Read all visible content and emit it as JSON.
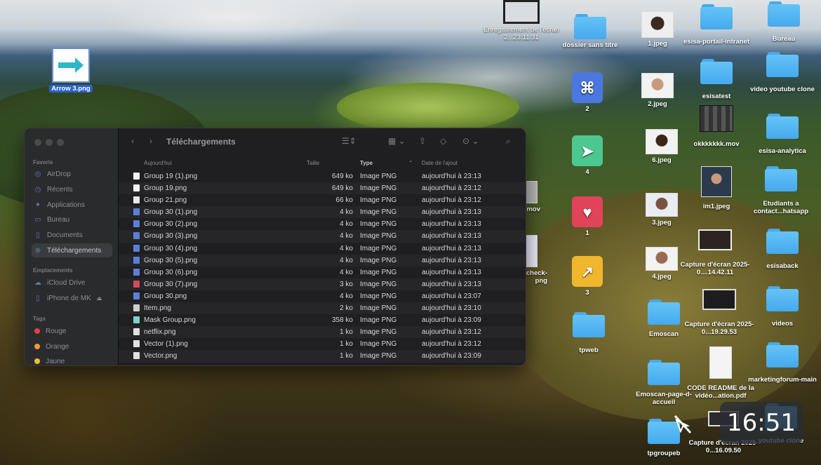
{
  "desktop": {
    "selected_icon": {
      "label": "Arrow 3.png"
    },
    "icons": {
      "recording": "Enregistrement de l'écran 2...23.11.31",
      "dossier": "dossier sans titre",
      "img1": "1.jpeg",
      "esisa_portail": "esisa-portail-intranet",
      "bureau": "Bureau",
      "app2": "2",
      "img2": "2.jpeg",
      "esisatest": "esisatest",
      "video_youtube": "video youtube clone",
      "mov": "okkkkkkk.mov",
      "img6": "6.jpeg",
      "app4": "4",
      "esisa_analytica": "esisa-analytica",
      "im1": "im1.jpeg",
      "etudiants": "Etudiants a contact...hatsapp",
      "app1": "1",
      "img3": "3.jpeg",
      "capture1": "Capture d'écran 2025-0....14.42.11",
      "esisaback": "esisaback",
      "app3": "3",
      "img4": "4.jpeg",
      "emoscan": "Emoscan",
      "capture2": "Capture d'écran 2025-0...19.29.53",
      "videos": "videos",
      "tpweb": "tpweb",
      "emoscan_page": "Emoscan-page-d-accueil",
      "code_readme": "CODE README de la vidéo...ation.pdf",
      "marketing": "marketingforum-main",
      "tpgroupeb": "tpgroupeb",
      "capture3": "Capture d'écran 2025-0...16.09.50",
      "youtube_clone": "youtube clone",
      "partial_mov": "mov",
      "partial_check": "check-\npng"
    },
    "app_symbols": {
      "app2": "⌘",
      "app4": "➤",
      "app1": "♥",
      "app3": "↗"
    }
  },
  "finder": {
    "title": "Téléchargements",
    "sidebar": {
      "favoris_label": "Favoris",
      "favoris": [
        "AirDrop",
        "Récents",
        "Applications",
        "Bureau",
        "Documents",
        "Téléchargements"
      ],
      "emplacements_label": "Emplacements",
      "emplacements": [
        "iCloud Drive",
        "iPhone de MK"
      ],
      "tags_label": "Tags",
      "tags": [
        "Rouge",
        "Orange",
        "Jaune"
      ]
    },
    "columns": {
      "name": "Aujourd'hui",
      "size": "Taille",
      "type": "Type",
      "date": "Date de l'ajout"
    },
    "files": [
      {
        "name": "Group 19 (1).png",
        "size": "649 ko",
        "type": "Image PNG",
        "date": "aujourd'hui à 23:13",
        "color": "#f2f2f2"
      },
      {
        "name": "Group 19.png",
        "size": "649 ko",
        "type": "Image PNG",
        "date": "aujourd'hui à 23:12",
        "color": "#f2f2f2"
      },
      {
        "name": "Group 21.png",
        "size": "66 ko",
        "type": "Image PNG",
        "date": "aujourd'hui à 23:12",
        "color": "#e8e8e8"
      },
      {
        "name": "Group 30 (1).png",
        "size": "4 ko",
        "type": "Image PNG",
        "date": "aujourd'hui à 23:13",
        "color": "#5b7fd6"
      },
      {
        "name": "Group 30 (2).png",
        "size": "4 ko",
        "type": "Image PNG",
        "date": "aujourd'hui à 23:13",
        "color": "#5b7fd6"
      },
      {
        "name": "Group 30 (3).png",
        "size": "4 ko",
        "type": "Image PNG",
        "date": "aujourd'hui à 23:13",
        "color": "#5b7fd6"
      },
      {
        "name": "Group 30 (4).png",
        "size": "4 ko",
        "type": "Image PNG",
        "date": "aujourd'hui à 23:13",
        "color": "#5b7fd6"
      },
      {
        "name": "Group 30 (5).png",
        "size": "4 ko",
        "type": "Image PNG",
        "date": "aujourd'hui à 23:13",
        "color": "#5b7fd6"
      },
      {
        "name": "Group 30 (6).png",
        "size": "4 ko",
        "type": "Image PNG",
        "date": "aujourd'hui à 23:13",
        "color": "#5b7fd6"
      },
      {
        "name": "Group 30 (7).png",
        "size": "3 ko",
        "type": "Image PNG",
        "date": "aujourd'hui à 23:13",
        "color": "#d14a5c"
      },
      {
        "name": "Group 30.png",
        "size": "4 ko",
        "type": "Image PNG",
        "date": "aujourd'hui à 23:07",
        "color": "#5b7fd6"
      },
      {
        "name": "Item.png",
        "size": "2 ko",
        "type": "Image PNG",
        "date": "aujourd'hui à 23:10",
        "color": "#cfcfcf"
      },
      {
        "name": "Mask Group.png",
        "size": "358 ko",
        "type": "Image PNG",
        "date": "aujourd'hui à 23:09",
        "color": "#7fd0c0"
      },
      {
        "name": "netflix.png",
        "size": "1 ko",
        "type": "Image PNG",
        "date": "aujourd'hui à 23:12",
        "color": "#e0e0e0"
      },
      {
        "name": "Vector (1).png",
        "size": "1 ko",
        "type": "Image PNG",
        "date": "aujourd'hui à 23:12",
        "color": "#e0e0e0"
      },
      {
        "name": "Vector.png",
        "size": "1 ko",
        "type": "Image PNG",
        "date": "aujourd'hui à 23:09",
        "color": "#e0e0e0"
      }
    ]
  },
  "overlay": {
    "clock": "16:51"
  },
  "colors": {
    "folder": "#4aaef0",
    "app2": "#4a78e0",
    "app4": "#4cc78f",
    "app1": "#e0435a",
    "app3": "#f0b72e",
    "tag_rouge": "#e0443e",
    "tag_orange": "#f29a2e",
    "tag_jaune": "#e6c229"
  }
}
